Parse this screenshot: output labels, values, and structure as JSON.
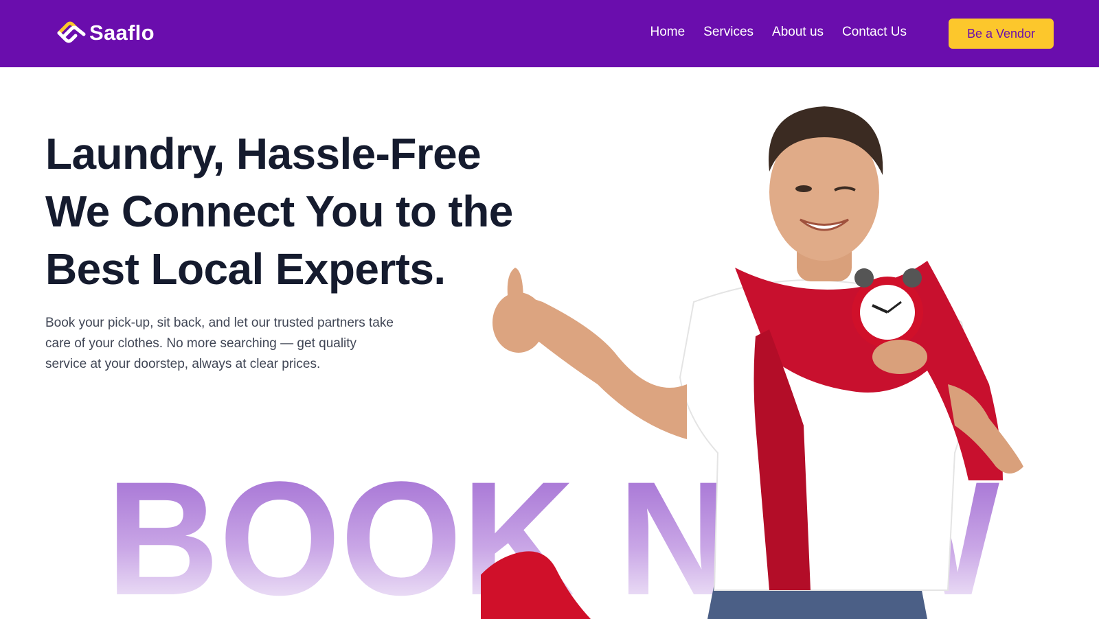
{
  "navbar": {
    "brand": "Saaflo",
    "links": [
      "Home",
      "Services",
      "About us",
      "Contact Us"
    ],
    "cta_label": "Be a Vendor"
  },
  "hero": {
    "title_lines": [
      "Laundry, Hassle-Free",
      "We Connect You to the",
      "Best Local Experts."
    ],
    "description": "Book your pick-up, sit back, and let our trusted partners take care of your clothes. No more searching — get quality service at your doorstep, always at clear prices.",
    "background_text": "BOOK NOW"
  },
  "colors": {
    "brand_purple": "#6a0dad",
    "accent_yellow": "#fcc72c",
    "heading": "#151b2e",
    "body_text": "#404655",
    "background_text_purple": "#9a63cf"
  },
  "icons": [
    "saaflo-logo-icon"
  ]
}
